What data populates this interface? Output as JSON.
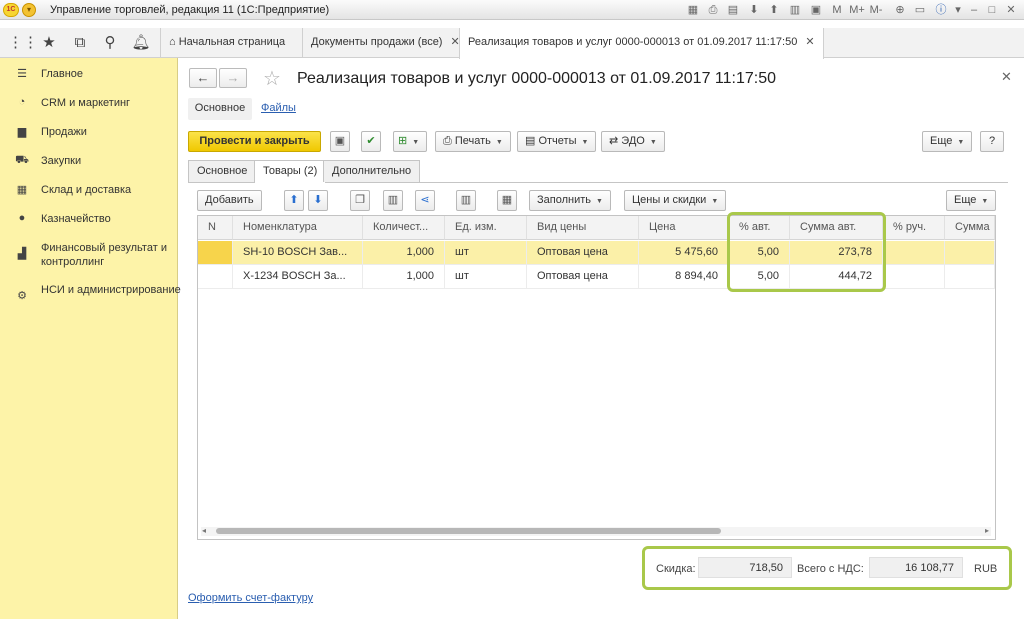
{
  "window": {
    "title": "Управление торговлей, редакция 11  (1С:Предприятие)",
    "logo": "1С"
  },
  "titlebar_tools": [
    "M",
    "M+",
    "M-"
  ],
  "tabs": [
    {
      "label": "Начальная страница"
    },
    {
      "label": "Документы продажи (все)"
    },
    {
      "label": "Реализация товаров и услуг 0000-000013 от 01.09.2017 11:17:50"
    }
  ],
  "sidebar": {
    "items": [
      {
        "label": "Главное",
        "icon": "menu-lines-icon"
      },
      {
        "label": "CRM и маркетинг",
        "icon": "pie-chart-icon"
      },
      {
        "label": "Продажи",
        "icon": "bag-icon"
      },
      {
        "label": "Закупки",
        "icon": "cart-icon"
      },
      {
        "label": "Склад и доставка",
        "icon": "warehouse-icon"
      },
      {
        "label": "Казначейство",
        "icon": "coin-icon"
      },
      {
        "label": "Финансовый результат и контроллинг",
        "icon": "bar-chart-icon"
      },
      {
        "label": "НСИ и администрирование",
        "icon": "gear-icon"
      }
    ]
  },
  "document": {
    "title": "Реализация товаров и услуг 0000-000013 от 01.09.2017 11:17:50",
    "subtabs": {
      "main": "Основное",
      "files": "Файлы"
    }
  },
  "toolbar": {
    "post_close": "Провести и закрыть",
    "print": "Печать",
    "reports": "Отчеты",
    "edo": "ЭДО",
    "more": "Еще",
    "help": "?"
  },
  "form_tabs": [
    "Основное",
    "Товары (2)",
    "Дополнительно"
  ],
  "grid_toolbar": {
    "add": "Добавить",
    "fill": "Заполнить",
    "prices": "Цены и скидки",
    "more": "Еще"
  },
  "grid": {
    "columns": [
      "N",
      "Номенклатура",
      "Количест...",
      "Ед. изм.",
      "Вид цены",
      "Цена",
      "% авт.",
      "Сумма авт.",
      "% руч.",
      "Сумма"
    ],
    "rows": [
      {
        "nomenclature": "SH-10 BOSCH Зав...",
        "qty": "1,000",
        "unit": "шт",
        "price_type": "Оптовая цена",
        "price": "5 475,60",
        "auto_pct": "5,00",
        "auto_sum": "273,78"
      },
      {
        "nomenclature": "X-1234 BOSCH За...",
        "qty": "1,000",
        "unit": "шт",
        "price_type": "Оптовая цена",
        "price": "8 894,40",
        "auto_pct": "5,00",
        "auto_sum": "444,72"
      }
    ]
  },
  "totals": {
    "discount_label": "Скидка:",
    "discount": "718,50",
    "total_label": "Всего с НДС:",
    "total": "16 108,77",
    "currency": "RUB"
  },
  "footer": {
    "invoice_link": "Оформить счет-фактуру"
  },
  "colors": {
    "sidebar": "#fdf3a8",
    "primary_button": "#f5d21e",
    "highlight": "#a9c84a",
    "selected_row": "#fbf0a8"
  }
}
